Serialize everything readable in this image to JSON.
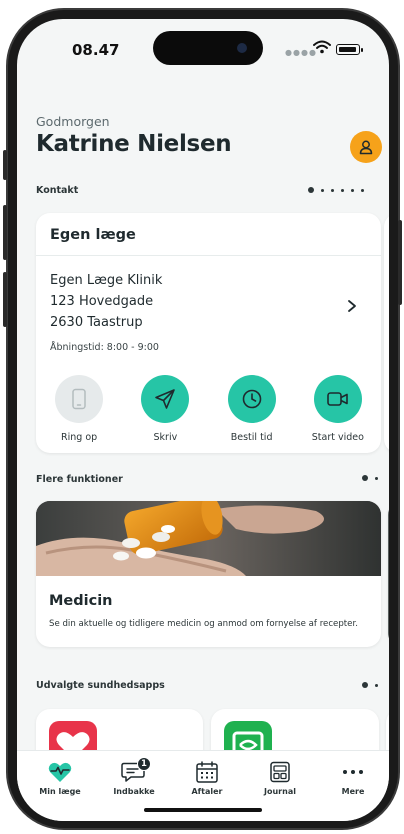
{
  "status_bar": {
    "time": "08.47"
  },
  "header": {
    "greeting": "Godmorgen",
    "user_name": "Katrine Nielsen"
  },
  "contact_section": {
    "label": "Kontakt",
    "page_count": 6,
    "active_page": 1
  },
  "doctor_card": {
    "title": "Egen læge",
    "clinic_name": "Egen Læge Klinik",
    "street": "123 Hovedgade",
    "city": "2630 Taastrup",
    "opening_hours": "Åbningstid: 8:00 - 9:00",
    "actions": [
      {
        "label": "Ring op",
        "icon": "phone-icon",
        "enabled": false
      },
      {
        "label": "Skriv",
        "icon": "send-icon",
        "enabled": true
      },
      {
        "label": "Bestil tid",
        "icon": "clock-icon",
        "enabled": true
      },
      {
        "label": "Start video",
        "icon": "video-icon",
        "enabled": true
      }
    ]
  },
  "more_section": {
    "label": "Flere funktioner",
    "page_count": 2,
    "active_page": 1
  },
  "medicine_card": {
    "title": "Medicin",
    "description": "Se din aktuelle og tidligere medicin og anmod om fornyelse af recepter."
  },
  "apps_section": {
    "label": "Udvalgte sundhedsapps",
    "page_count": 2,
    "active_page": 1
  },
  "tab_bar": {
    "items": [
      {
        "label": "Min læge",
        "icon": "heart-pulse-icon",
        "active": true
      },
      {
        "label": "Indbakke",
        "icon": "chat-icon",
        "badge": "1"
      },
      {
        "label": "Aftaler",
        "icon": "calendar-icon"
      },
      {
        "label": "Journal",
        "icon": "journal-icon"
      },
      {
        "label": "Mere",
        "icon": "more-icon"
      }
    ]
  },
  "colors": {
    "accent": "#26c5a6",
    "avatar": "#f6a21a",
    "text": "#1f2a2e",
    "background": "#f4f6f6"
  }
}
